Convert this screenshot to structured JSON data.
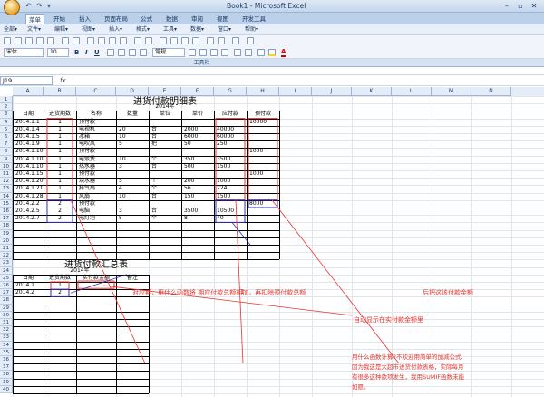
{
  "window": {
    "title": "Book1 - Microsoft Excel",
    "minimize": "–",
    "restore": "▫",
    "close": "✕"
  },
  "quick_access": [
    "↶",
    "↷",
    "▾"
  ],
  "ribbon_tabs": [
    "插入",
    "页面布局",
    "公式",
    "数据",
    "审阅",
    "视图",
    "开发工具"
  ],
  "active_tab": "菜单",
  "tab_start": "开始",
  "menu_items": [
    "全部▾",
    "文件▾",
    "编辑▾",
    "视图▾",
    "插入▾",
    "格式▾",
    "工具▾",
    "数据▾",
    "窗口▾",
    "帮助▾"
  ],
  "font_name": "宋体",
  "font_size": "10",
  "number_format": "常规",
  "toolbar_label": "工具栏",
  "name_box": "J19",
  "fx": "fx",
  "columns": [
    "A",
    "B",
    "C",
    "D",
    "E",
    "F",
    "G",
    "H",
    "I",
    "J",
    "K",
    "L",
    "M",
    "N"
  ],
  "rows": [
    "1",
    "2",
    "3",
    "4",
    "5",
    "6",
    "7",
    "8",
    "9",
    "10",
    "11",
    "12",
    "13",
    "14",
    "15",
    "16",
    "17",
    "18",
    "19",
    "20",
    "21",
    "22",
    "23",
    "24",
    "25",
    "26",
    "27",
    "28",
    "29",
    "30",
    "31",
    "32",
    "33",
    "34",
    "35",
    "36",
    "37",
    "38",
    "39",
    "40"
  ],
  "detail": {
    "title": "进货付款明细表",
    "year": "2014年",
    "headers": [
      "日期",
      "进货期数",
      "名称",
      "数量",
      "单位",
      "单价",
      "应付款",
      "预付款"
    ],
    "rows": [
      [
        "2014.1.1",
        "1",
        "预付款",
        "",
        "",
        "",
        "",
        "10000"
      ],
      [
        "2014.1.4",
        "1",
        "电视机",
        "20",
        "台",
        "2000",
        "40000",
        ""
      ],
      [
        "2014.1.5",
        "1",
        "冰箱",
        "10",
        "台",
        "6000",
        "60000",
        ""
      ],
      [
        "2014.1.9",
        "1",
        "电吹风",
        "5",
        "把",
        "50",
        "250",
        ""
      ],
      [
        "2014.1.10",
        "1",
        "预付款",
        "",
        "",
        "",
        "",
        "1000"
      ],
      [
        "2014.1.10",
        "1",
        "电饭煲",
        "10",
        "个",
        "350",
        "3500",
        ""
      ],
      [
        "2014.1.10",
        "1",
        "热水器",
        "3",
        "台",
        "500",
        "1500",
        ""
      ],
      [
        "2014.1.15",
        "1",
        "预付款",
        "",
        "",
        "",
        "",
        "1000"
      ],
      [
        "2014.1.20",
        "1",
        "烧水器",
        "5",
        "个",
        "200",
        "1000",
        ""
      ],
      [
        "2014.1.21",
        "1",
        "排气扇",
        "4",
        "个",
        "56",
        "224",
        ""
      ],
      [
        "2014.1.28",
        "1",
        "风扇",
        "10",
        "台",
        "150",
        "1500",
        ""
      ],
      [
        "2014.2.2",
        "2",
        "预付款",
        "",
        "",
        "",
        "",
        "8000"
      ],
      [
        "2014.2.5",
        "2",
        "电脑",
        "3",
        "台",
        "3500",
        "10500",
        ""
      ],
      [
        "2014.2.7",
        "2",
        "电灯泡",
        "5",
        "个",
        "8",
        "40",
        ""
      ]
    ]
  },
  "summary": {
    "title": "进货付款汇总表",
    "year": "2014年",
    "headers": [
      "日期",
      "进货期数",
      "实付款金额",
      "备注"
    ],
    "rows": [
      [
        "2014.1",
        "1",
        "",
        ""
      ],
      [
        "2014.2",
        "2",
        "",
        ""
      ]
    ]
  },
  "annotations": {
    "main": "对应期，用什么函数将   期应付款总额相加，再扣除预付款总额",
    "digit": "1",
    "after": "后把这该付款金额",
    "auto": "自动显示在实付款金额里",
    "note_lines": [
      "用什么函数计算?不欢迎用简单的加减公式,",
      "因为我这是大超市进货付款表格，实际每月",
      "有很多这种款项发生，我用SUMIF函数未能",
      "如愿。"
    ]
  },
  "colors": {
    "accent_red": "#e8322f",
    "annotation_blue": "#2b2fb8"
  }
}
